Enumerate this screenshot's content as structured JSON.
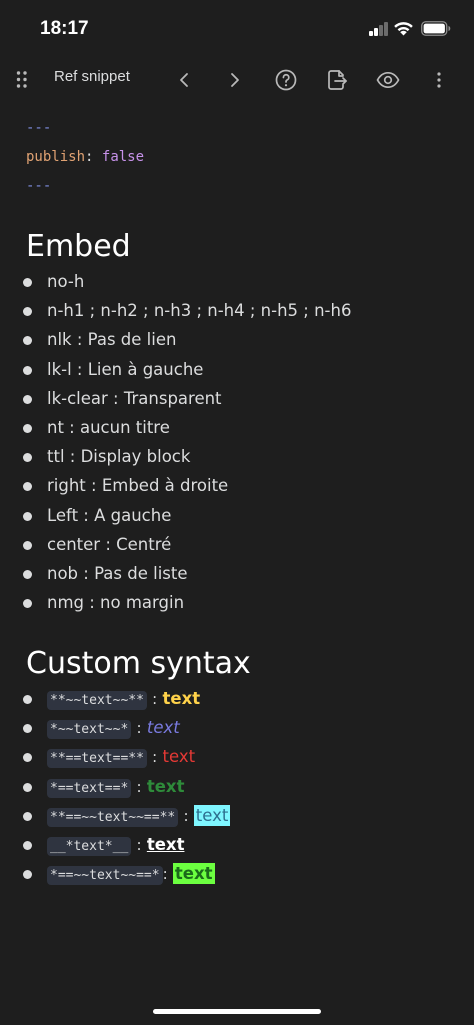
{
  "status_bar": {
    "time": "18:17"
  },
  "toolbar": {
    "title": "Ref snippet"
  },
  "frontmatter": {
    "dash_open": "---",
    "key": "publish",
    "colon": ":",
    "value": "false",
    "dash_close": "---"
  },
  "embed": {
    "heading": "Embed",
    "items": [
      "no-h",
      "n-h1 ; n-h2 ; n-h3 ; n-h4 ; n-h5 ; n-h6",
      "nlk : Pas de lien",
      "lk-l : Lien à gauche",
      "lk-clear : Transparent",
      "nt : aucun titre",
      "ttl : Display block",
      "right : Embed à droite",
      "Left : A gauche",
      "center : Centré",
      "nob : Pas de liste",
      "nmg : no margin"
    ]
  },
  "custom": {
    "heading": "Custom syntax",
    "separator": ":",
    "items": [
      {
        "code": "**~~text~~**",
        "sample": "text"
      },
      {
        "code": "*~~text~~*",
        "sample": "text"
      },
      {
        "code": "**==text==**",
        "sample": "text"
      },
      {
        "code": "*==text==*",
        "sample": "text"
      },
      {
        "code": "**==~~text~~==**",
        "sample": "text"
      },
      {
        "code": "__*text*__",
        "sample": "text"
      },
      {
        "code": "*==~~text~~==*",
        "sample": "text"
      }
    ]
  },
  "colors": {
    "background": "#1e1e1e",
    "text": "#dcddde",
    "inline_code_bg": "#2f3440"
  },
  "icons": [
    "drag-handle-icon",
    "chevron-left-icon",
    "chevron-right-icon",
    "help-circle-icon",
    "export-icon",
    "eye-icon",
    "more-vertical-icon"
  ]
}
